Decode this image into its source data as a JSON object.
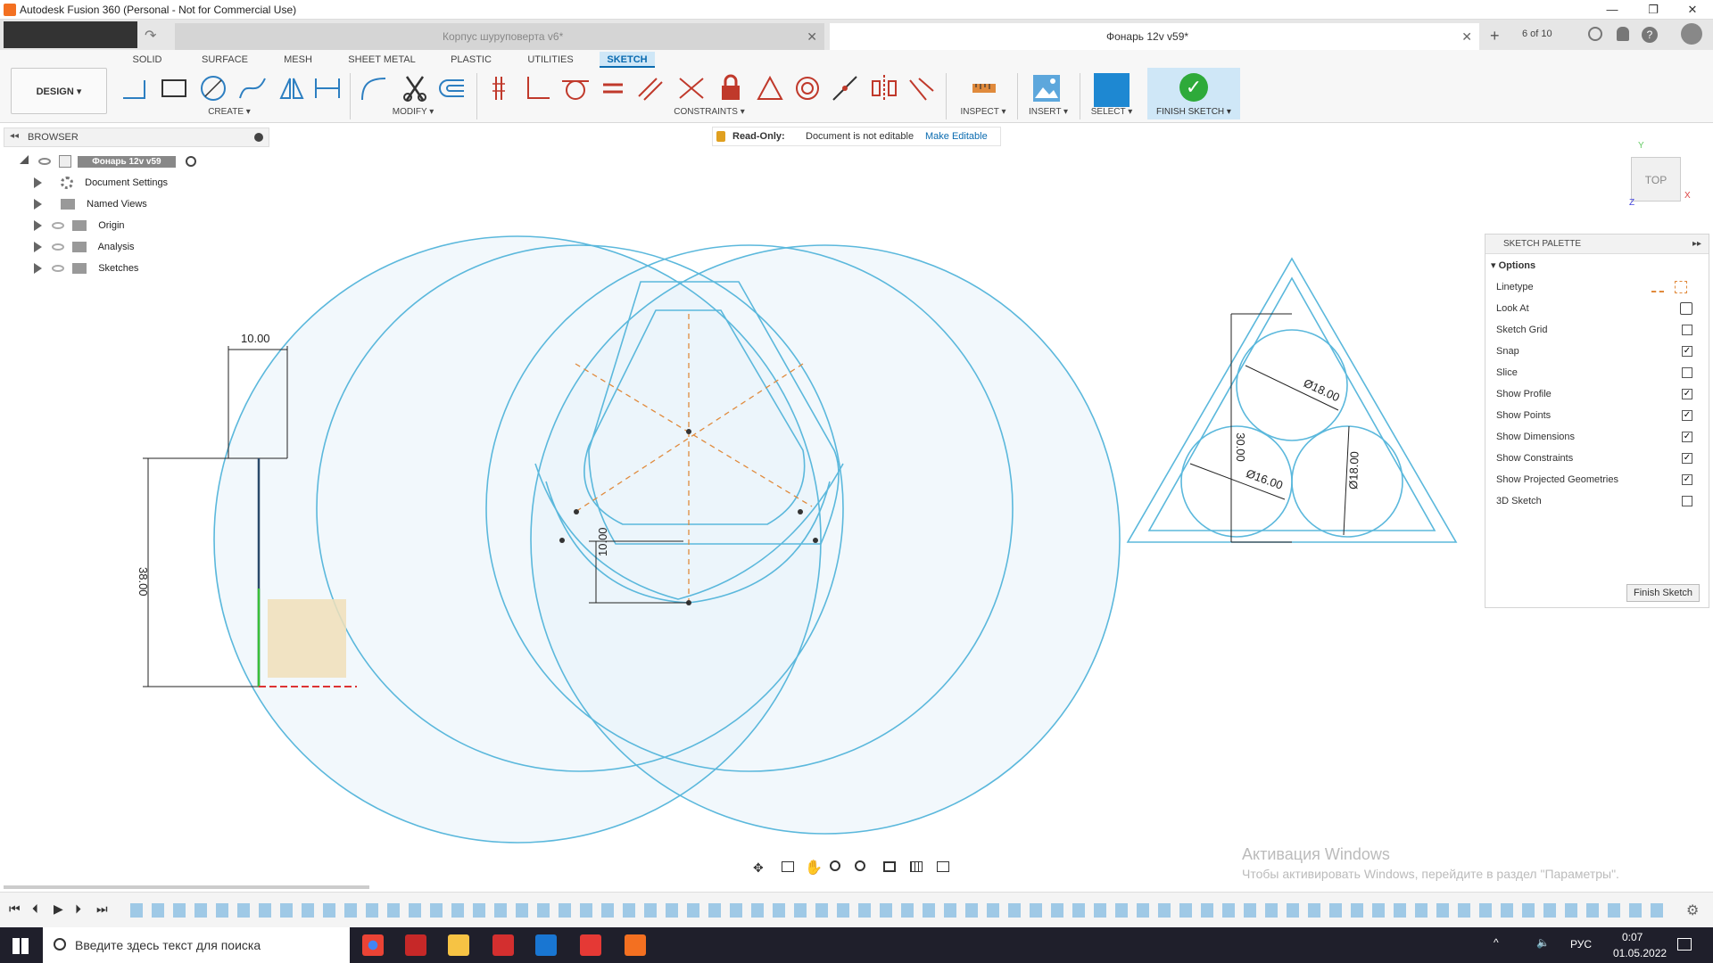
{
  "window": {
    "title": "Autodesk Fusion 360 (Personal - Not for Commercial Use)",
    "minimize": "—",
    "maximize": "❐",
    "close": "✕"
  },
  "document_tabs": [
    {
      "label": "Корпус шуруповерта v6*",
      "active": false
    },
    {
      "label": "Фонарь 12v v59*",
      "active": true
    }
  ],
  "tab_bar_right": {
    "job_status": "6 of 10"
  },
  "workspace_tabs": [
    "SOLID",
    "SURFACE",
    "MESH",
    "SHEET METAL",
    "PLASTIC",
    "UTILITIES",
    "SKETCH"
  ],
  "active_workspace_tab": "SKETCH",
  "design_button": "DESIGN ▾",
  "tool_groups": {
    "create": "CREATE ▾",
    "modify": "MODIFY ▾",
    "constraints": "CONSTRAINTS ▾",
    "inspect": "INSPECT ▾",
    "insert": "INSERT ▾",
    "select": "SELECT ▾",
    "finish_sketch": "FINISH SKETCH ▾"
  },
  "browser": {
    "header": "BROWSER",
    "root": "Фонарь 12v v59",
    "items": [
      "Document Settings",
      "Named Views",
      "Origin",
      "Analysis",
      "Sketches"
    ]
  },
  "readonly_bar": {
    "label": "Read-Only:",
    "message": "Document is not editable",
    "action": "Make Editable"
  },
  "viewcube": {
    "face": "TOP",
    "axis_x": "X",
    "axis_y": "Y",
    "axis_z": "Z"
  },
  "sketch_palette": {
    "title": "SKETCH PALETTE",
    "section": "Options",
    "options": [
      {
        "label": "Linetype",
        "kind": "icons"
      },
      {
        "label": "Look At",
        "kind": "icon"
      },
      {
        "label": "Sketch Grid",
        "checked": false
      },
      {
        "label": "Snap",
        "checked": true
      },
      {
        "label": "Slice",
        "checked": false
      },
      {
        "label": "Show Profile",
        "checked": true
      },
      {
        "label": "Show Points",
        "checked": true
      },
      {
        "label": "Show Dimensions",
        "checked": true
      },
      {
        "label": "Show Constraints",
        "checked": true
      },
      {
        "label": "Show Projected Geometries",
        "checked": true
      },
      {
        "label": "3D Sketch",
        "checked": false
      }
    ],
    "finish_button": "Finish Sketch"
  },
  "dimensions": {
    "d1": "10.00",
    "d2": "38.00",
    "d3": "10.00",
    "d4": "Ø18.00",
    "d5": "Ø16.00",
    "d6": "Ø18.00",
    "d7": "30.00"
  },
  "watermark": {
    "line1": "Активация Windows",
    "line2": "Чтобы активировать Windows, перейдите в раздел \"Параметры\"."
  },
  "taskbar": {
    "search_placeholder": "Введите здесь текст для поиска",
    "language": "РУС",
    "time": "0:07",
    "date": "01.05.2022"
  },
  "colors": {
    "sketch_line": "#5bb8dc",
    "profile_fill": "#e8f3fa",
    "accent": "#0a6bb0",
    "construction": "#e08a3c"
  }
}
